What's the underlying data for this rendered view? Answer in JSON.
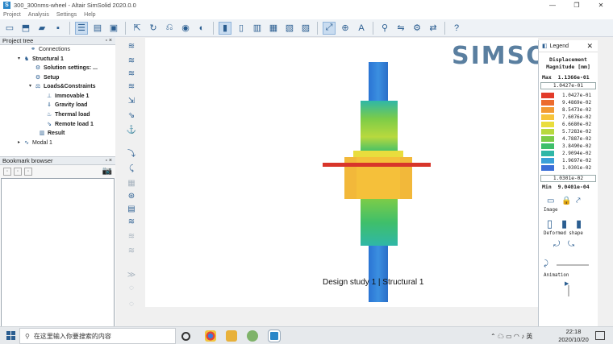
{
  "window": {
    "title": "300_300nms-wheel - Altair SimSolid 2020.0.0",
    "minimize": "—",
    "restore": "❐",
    "close": "✕"
  },
  "menu": [
    "Project",
    "Analysis",
    "Settings",
    "Help"
  ],
  "project_tree": {
    "title": "Project tree",
    "pin": "▫ ×",
    "items": [
      {
        "label": "Connections",
        "icon": "connections-icon",
        "bold": false
      },
      {
        "label": "Structural  1",
        "icon": "structural-study-icon",
        "bold": true,
        "twist": "▾"
      },
      {
        "label": "Solution settings: ...",
        "icon": "gear-icon",
        "bold": true
      },
      {
        "label": "Setup",
        "icon": "setup-icon",
        "bold": true
      },
      {
        "label": "Loads&Constraints",
        "icon": "loads-icon",
        "bold": true,
        "twist": "▾"
      },
      {
        "label": "Immovable 1",
        "icon": "immovable-icon",
        "bold": true
      },
      {
        "label": "Gravity load",
        "icon": "gravity-icon",
        "bold": true
      },
      {
        "label": "Thermal load",
        "icon": "thermal-icon",
        "bold": true
      },
      {
        "label": "Remote load 1",
        "icon": "remote-load-icon",
        "bold": true
      },
      {
        "label": "Result",
        "icon": "result-icon",
        "bold": true
      },
      {
        "label": "Modal 1",
        "icon": "modal-study-icon",
        "bold": false,
        "twist": "▸"
      }
    ]
  },
  "bookmark_browser": {
    "title": "Bookmark browser",
    "pin": "▫ ×"
  },
  "viewport": {
    "watermark": "SIMSOLID",
    "caption": "Design study 1 | Structural  1"
  },
  "legend": {
    "title": "Legend",
    "close": "✕",
    "quantity": "Displacement",
    "unit_line": "Magnitude [mm]",
    "max_label": "Max",
    "max_value": "1.1366e-01",
    "upper_bound": "1.0427e-01",
    "levels": [
      {
        "value": "1.0427e-01",
        "color": "#e23b2a"
      },
      {
        "value": "9.4869e-02",
        "color": "#ec6b2d"
      },
      {
        "value": "8.5473e-02",
        "color": "#f29a33"
      },
      {
        "value": "7.6076e-02",
        "color": "#f7c43b"
      },
      {
        "value": "6.6680e-02",
        "color": "#e9dd3d"
      },
      {
        "value": "5.7283e-02",
        "color": "#b8d93e"
      },
      {
        "value": "4.7887e-02",
        "color": "#7ccc48"
      },
      {
        "value": "3.8490e-02",
        "color": "#3fbf6a"
      },
      {
        "value": "2.9094e-02",
        "color": "#2fb7a7"
      },
      {
        "value": "1.9697e-02",
        "color": "#3aa0d8"
      },
      {
        "value": "1.0301e-02",
        "color": "#3b6fd8"
      }
    ],
    "lower_bound": "1.0301e-02",
    "min_label": "Min",
    "min_value": "9.0401e-04",
    "image_label": "Image",
    "deformed_label": "Deformed shape",
    "animation_label": "Animation"
  },
  "taskbar": {
    "search_placeholder": "在这里输入你要搜索的内容",
    "time": "22:18",
    "date": "2020/10/20"
  }
}
